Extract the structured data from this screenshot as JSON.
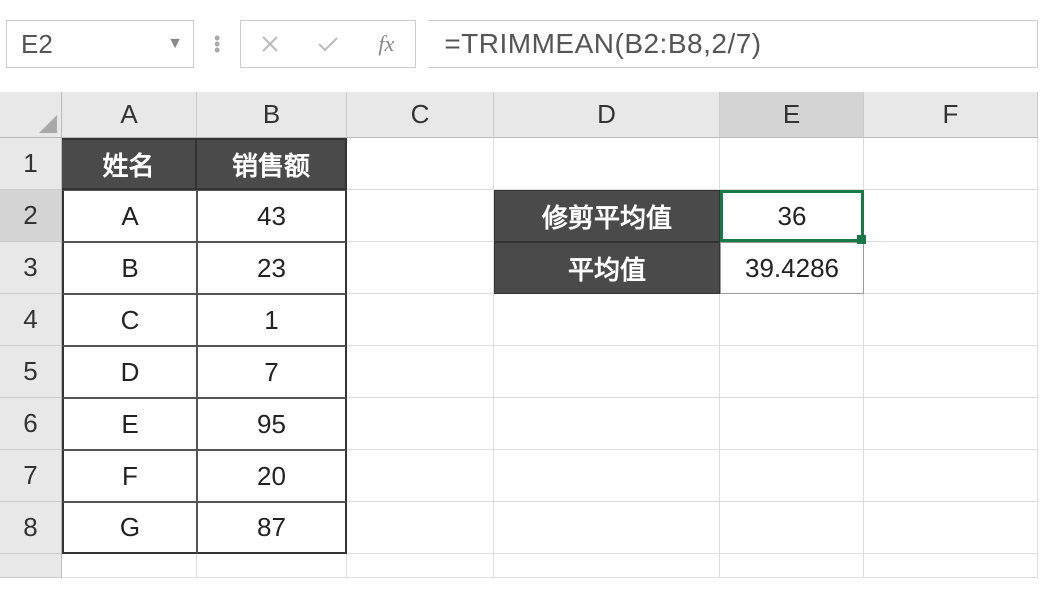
{
  "nameBox": {
    "value": "E2"
  },
  "formulaBar": {
    "fxLabel": "fx",
    "formula": "=TRIMMEAN(B2:B8,2/7)"
  },
  "columns": [
    "A",
    "B",
    "C",
    "D",
    "E",
    "F"
  ],
  "rowNumbers": [
    "1",
    "2",
    "3",
    "4",
    "5",
    "6",
    "7",
    "8"
  ],
  "headers": {
    "name": "姓名",
    "sales": "销售额"
  },
  "records": [
    {
      "name": "A",
      "sales": "43"
    },
    {
      "name": "B",
      "sales": "23"
    },
    {
      "name": "C",
      "sales": "1"
    },
    {
      "name": "D",
      "sales": "7"
    },
    {
      "name": "E",
      "sales": "95"
    },
    {
      "name": "F",
      "sales": "20"
    },
    {
      "name": "G",
      "sales": "87"
    }
  ],
  "sideLabels": {
    "trimmedMean": "修剪平均值",
    "mean": "平均值"
  },
  "results": {
    "trimmedMean": "36",
    "mean": "39.4286"
  },
  "activeCell": "E2",
  "chart_data": {
    "type": "table",
    "title": "",
    "columns": [
      "姓名",
      "销售额"
    ],
    "rows": [
      [
        "A",
        43
      ],
      [
        "B",
        23
      ],
      [
        "C",
        1
      ],
      [
        "D",
        7
      ],
      [
        "E",
        95
      ],
      [
        "F",
        20
      ],
      [
        "G",
        87
      ]
    ],
    "derived": {
      "修剪平均值": 36,
      "平均值": 39.4286
    }
  }
}
